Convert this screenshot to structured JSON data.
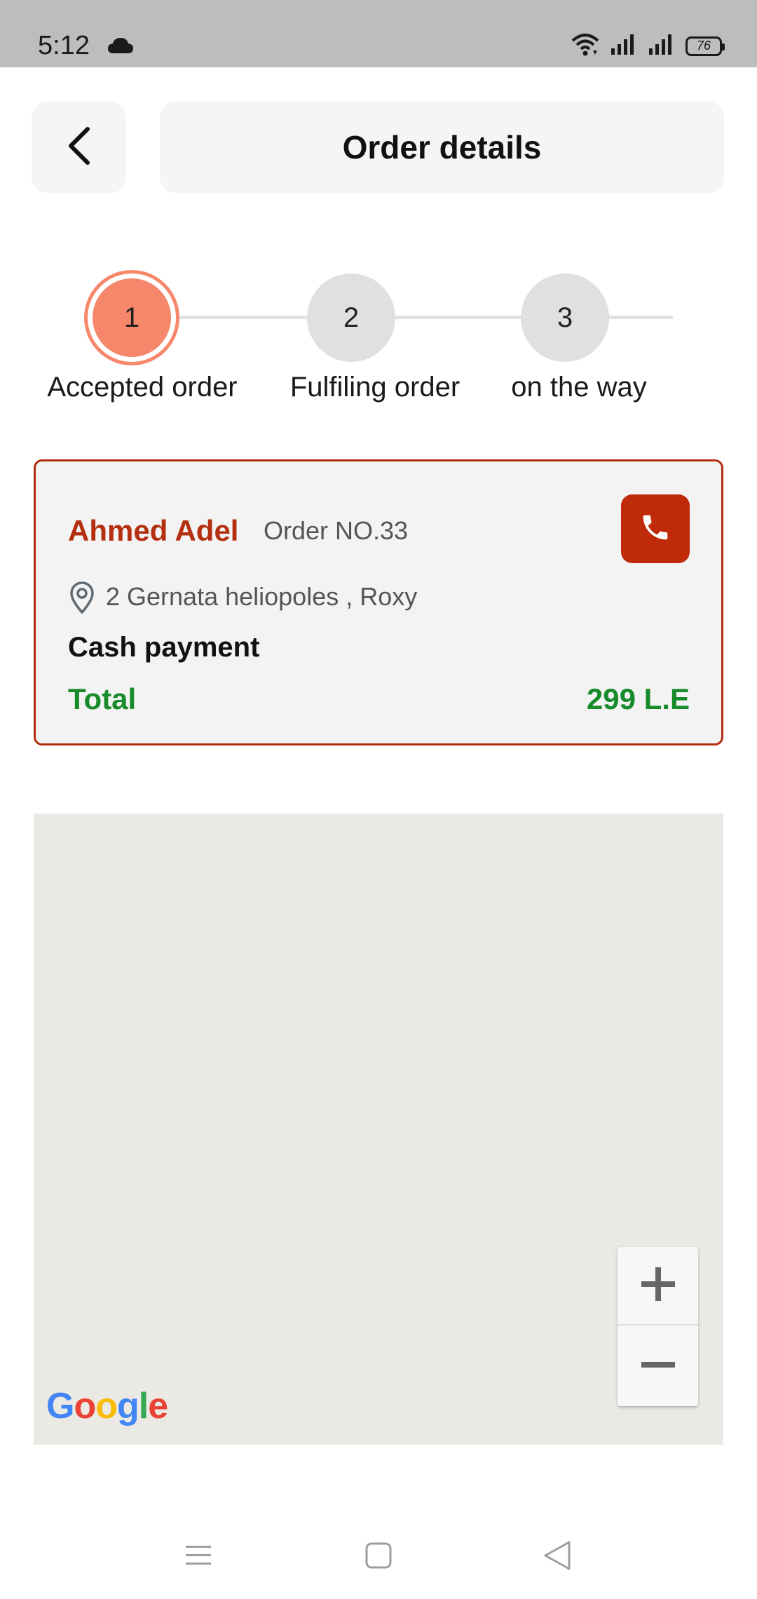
{
  "status_bar": {
    "time": "5:12",
    "battery": "76",
    "icons": [
      "cloud-icon",
      "wifi-icon",
      "signal-icon",
      "signal-icon",
      "battery-icon"
    ]
  },
  "header": {
    "back_icon": "chevron-left-icon",
    "title": "Order details"
  },
  "stepper": {
    "current_step": 1,
    "active_color": "#f7876b",
    "steps": [
      {
        "number": "1",
        "label": "Accepted order"
      },
      {
        "number": "2",
        "label": "Fulfiling order"
      },
      {
        "number": "3",
        "label": "on the way"
      }
    ]
  },
  "order": {
    "customer_name": "Ahmed Adel",
    "order_number": "Order NO.33",
    "address": "2 Gernata heliopoles , Roxy",
    "payment_method": "Cash payment",
    "total_label": "Total",
    "total_value": "299 L.E",
    "accent_color": "#b42f10",
    "total_color": "#178a2a",
    "call_icon": "phone-icon",
    "location_icon": "map-pin-icon"
  },
  "map": {
    "attribution": "Google",
    "zoom_in_icon": "plus-icon",
    "zoom_out_icon": "minus-icon"
  },
  "nav_bar": {
    "icons": [
      "menu-icon",
      "home-square-icon",
      "back-triangle-icon"
    ]
  }
}
